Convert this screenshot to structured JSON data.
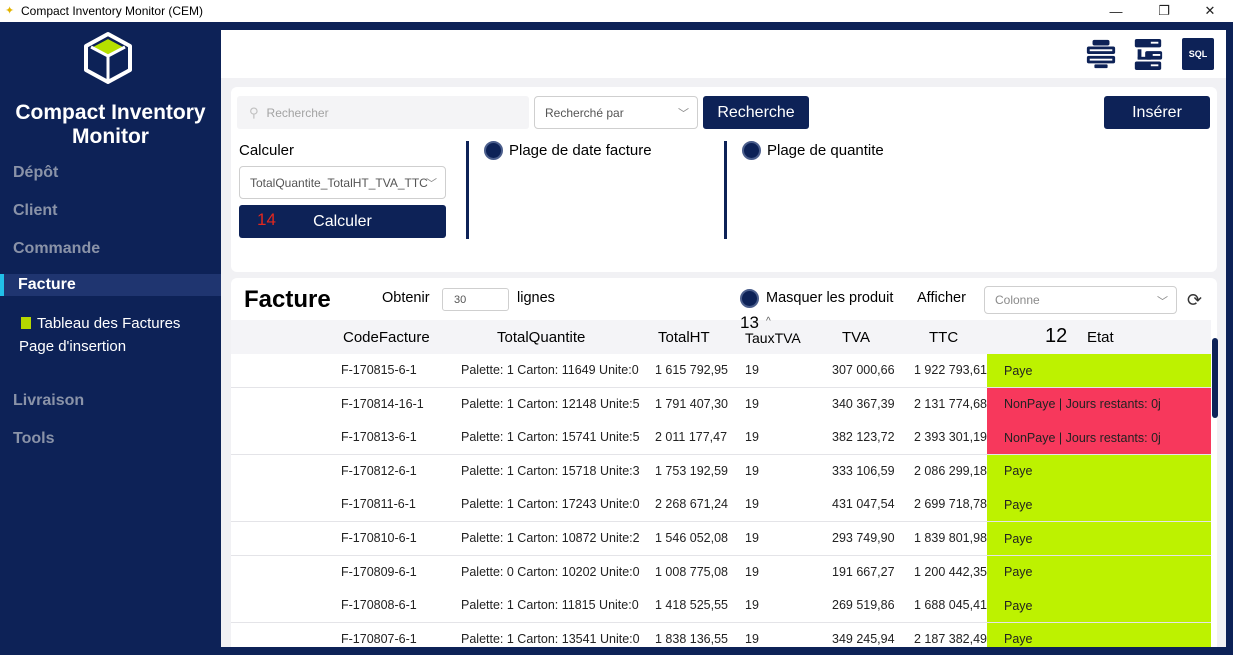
{
  "window": {
    "title": "Compact Inventory Monitor (CEM)"
  },
  "sidebar": {
    "brand_line1": "Compact Inventory",
    "brand_line2": "Monitor",
    "items": [
      "Dépôt",
      "Client",
      "Commande",
      "Facture",
      "Livraison",
      "Tools"
    ],
    "sub_items": [
      "Tableau des Factures",
      "Page d'insertion"
    ]
  },
  "topbar": {
    "sql_label": "SQL"
  },
  "search": {
    "placeholder": "Rechercher",
    "by_placeholder": "Recherché par",
    "button": "Recherche"
  },
  "insert_button": "Insérer",
  "calc": {
    "label": "Calculer",
    "selected": "TotalQuantite_TotalHT_TVA_TTC",
    "button": "Calculer",
    "annotation": "14"
  },
  "ranges": {
    "date": "Plage de date facture",
    "quantity": "Plage de quantite"
  },
  "table_panel": {
    "title": "Facture",
    "obtain_label": "Obtenir",
    "rows_value": "30",
    "rows_label": "lignes",
    "hide_products": "Masquer les produit",
    "show_label": "Afficher",
    "column_placeholder": "Colonne",
    "annotation_13": "13",
    "annotation_12": "12",
    "sort_indicator": "^"
  },
  "table": {
    "columns": [
      "CodeFacture",
      "TotalQuantite",
      "TotalHT",
      "TauxTVA",
      "TVA",
      "TTC",
      "Etat"
    ],
    "rows": [
      [
        "F-170815-6-1",
        "Palette: 1 Carton: 11649 Unite:0",
        "1 615 792,95",
        "19",
        "307 000,66",
        "1 922 793,61",
        "Paye"
      ],
      [
        "F-170814-16-1",
        "Palette: 1 Carton: 12148 Unite:5",
        "1 791 407,30",
        "19",
        "340 367,39",
        "2 131 774,68",
        "NonPaye | Jours restants: 0j"
      ],
      [
        "F-170813-6-1",
        "Palette: 1 Carton: 15741 Unite:5",
        "2 011 177,47",
        "19",
        "382 123,72",
        "2 393 301,19",
        "NonPaye | Jours restants: 0j"
      ],
      [
        "F-170812-6-1",
        "Palette: 1 Carton: 15718 Unite:3",
        "1 753 192,59",
        "19",
        "333 106,59",
        "2 086 299,18",
        "Paye"
      ],
      [
        "F-170811-6-1",
        "Palette: 1 Carton: 17243 Unite:0",
        "2 268 671,24",
        "19",
        "431 047,54",
        "2 699 718,78",
        "Paye"
      ],
      [
        "F-170810-6-1",
        "Palette: 1 Carton: 10872 Unite:2",
        "1 546 052,08",
        "19",
        "293 749,90",
        "1 839 801,98",
        "Paye"
      ],
      [
        "F-170809-6-1",
        "Palette: 0 Carton: 10202 Unite:0",
        "1 008 775,08",
        "19",
        "191 667,27",
        "1 200 442,35",
        "Paye"
      ],
      [
        "F-170808-6-1",
        "Palette: 1 Carton: 11815 Unite:0",
        "1 418 525,55",
        "19",
        "269 519,86",
        "1 688 045,41",
        "Paye"
      ],
      [
        "F-170807-6-1",
        "Palette: 1 Carton: 13541 Unite:0",
        "1 838 136,55",
        "19",
        "349 245,94",
        "2 187 382,49",
        "Paye"
      ]
    ]
  },
  "colors": {
    "navy": "#0d2257",
    "paid": "#bdf200",
    "unpaid": "#f7385c",
    "accent": "#21c0e8"
  }
}
